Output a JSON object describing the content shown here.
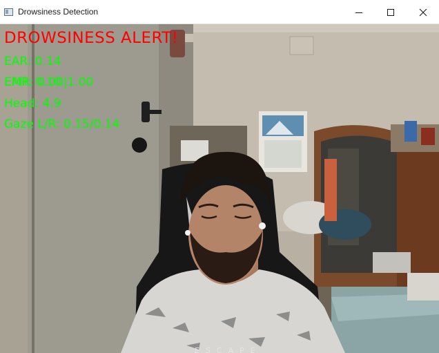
{
  "window": {
    "title": "Drowsiness Detection",
    "icon": "app-window-icon",
    "controls": {
      "minimize": "minimize-icon",
      "maximize": "maximize-icon",
      "close": "close-icon"
    }
  },
  "overlay": {
    "alert": "DROWSINESS ALERT!",
    "ear": "EAR: 0.14",
    "emr": "EMR: 0.00|1.00",
    "emr_ghost": "EAR: 0.10",
    "head": "Head: 4.9",
    "gaze": "Gaze L/R: 0.15/0.14"
  },
  "watermark": "ESCAPE",
  "colors": {
    "alert": "#ff0000",
    "metric": "#00ff00",
    "titlebar": "#ffffff"
  }
}
